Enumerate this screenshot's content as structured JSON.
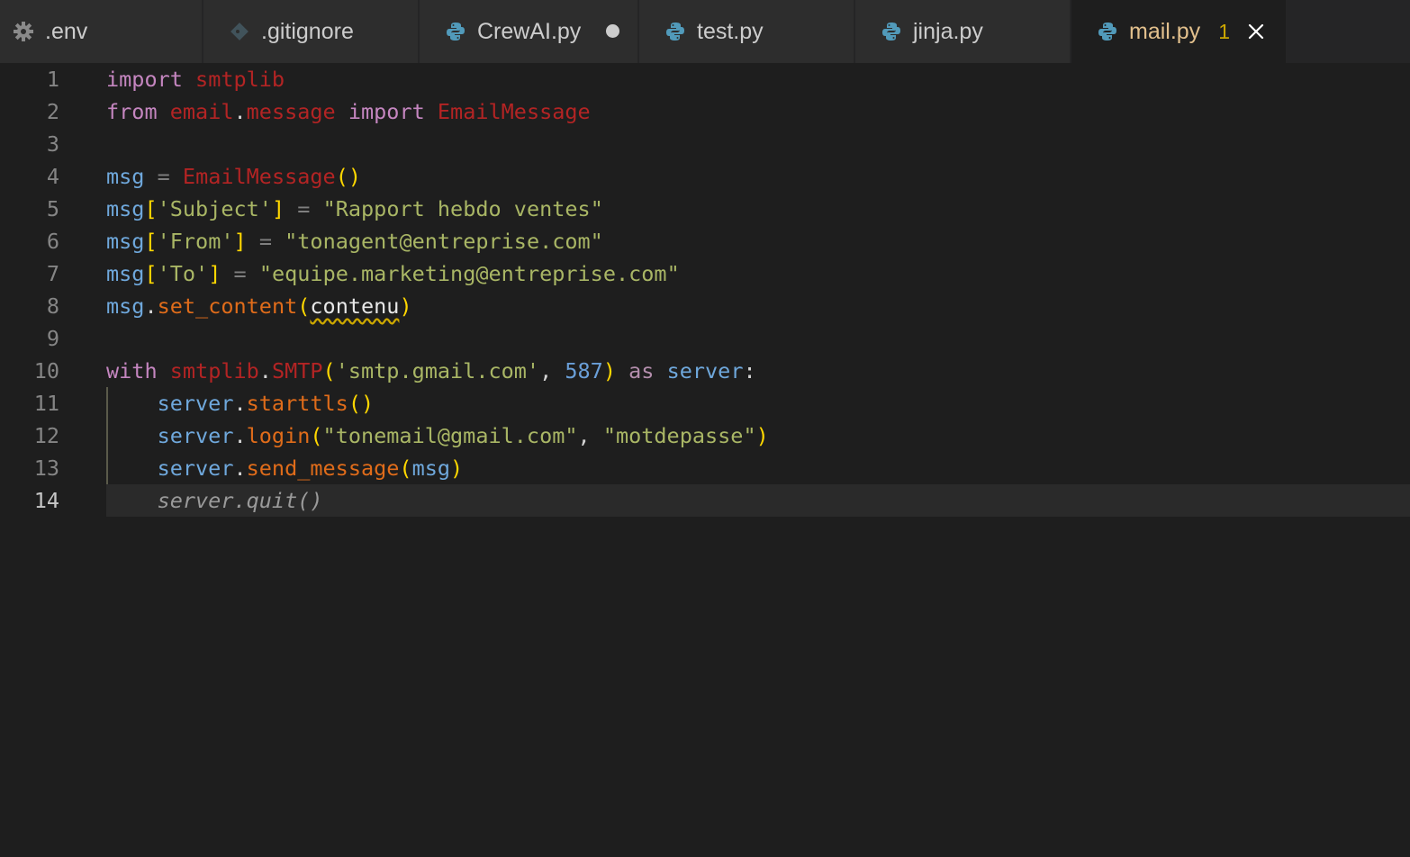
{
  "colors": {
    "editor_bg": "#1e1e1e",
    "tabbar_bg": "#252526",
    "inactive_tab_bg": "#2d2d2d",
    "active_tab_text": "#e2c08d",
    "warning_badge": "#cca700",
    "python_icon": "#519aba"
  },
  "tabs": [
    {
      "label": ".env",
      "icon": "gear-icon"
    },
    {
      "label": ".gitignore",
      "icon": "git-icon"
    },
    {
      "label": "CrewAI.py",
      "icon": "python-icon",
      "modified": true
    },
    {
      "label": "test.py",
      "icon": "python-icon"
    },
    {
      "label": "jinja.py",
      "icon": "python-icon"
    },
    {
      "label": "mail.py",
      "icon": "python-icon",
      "active": true,
      "problems": "1"
    }
  ],
  "lines": {
    "1": {
      "num": "1",
      "t": [
        "import",
        " ",
        "smtplib"
      ]
    },
    "2": {
      "num": "2",
      "t": [
        "from",
        " ",
        "email",
        ".",
        "message",
        " ",
        "import",
        " ",
        "EmailMessage"
      ]
    },
    "3": {
      "num": "3"
    },
    "4": {
      "num": "4",
      "t": [
        "msg",
        " ",
        "=",
        " ",
        "EmailMessage",
        "()"
      ]
    },
    "5": {
      "num": "5",
      "t": [
        "msg",
        "[",
        "'Subject'",
        "]",
        " ",
        "=",
        " ",
        "\"Rapport hebdo ventes\""
      ]
    },
    "6": {
      "num": "6",
      "t": [
        "msg",
        "[",
        "'From'",
        "]",
        " ",
        "=",
        " ",
        "\"tonagent@entreprise.com\""
      ]
    },
    "7": {
      "num": "7",
      "t": [
        "msg",
        "[",
        "'To'",
        "]",
        " ",
        "=",
        " ",
        "\"equipe.marketing@entreprise.com\""
      ]
    },
    "8": {
      "num": "8",
      "t": [
        "msg",
        ".",
        "set_content",
        "(",
        "contenu",
        ")"
      ]
    },
    "9": {
      "num": "9"
    },
    "10": {
      "num": "10",
      "t": [
        "with",
        " ",
        "smtplib",
        ".",
        "SMTP",
        "(",
        "'smtp.gmail.com'",
        ", ",
        "587",
        ")",
        " ",
        "as",
        " ",
        "server",
        ":"
      ]
    },
    "11": {
      "num": "11",
      "t": [
        "    ",
        "server",
        ".",
        "starttls",
        "()"
      ]
    },
    "12": {
      "num": "12",
      "t": [
        "    ",
        "server",
        ".",
        "login",
        "(",
        "\"tonemail@gmail.com\"",
        ", ",
        "\"motdepasse\"",
        ")"
      ]
    },
    "13": {
      "num": "13",
      "t": [
        "    ",
        "server",
        ".",
        "send_message",
        "(",
        "msg",
        ")"
      ]
    },
    "14": {
      "num": "14",
      "t": [
        "    ",
        "server.quit()"
      ]
    }
  }
}
